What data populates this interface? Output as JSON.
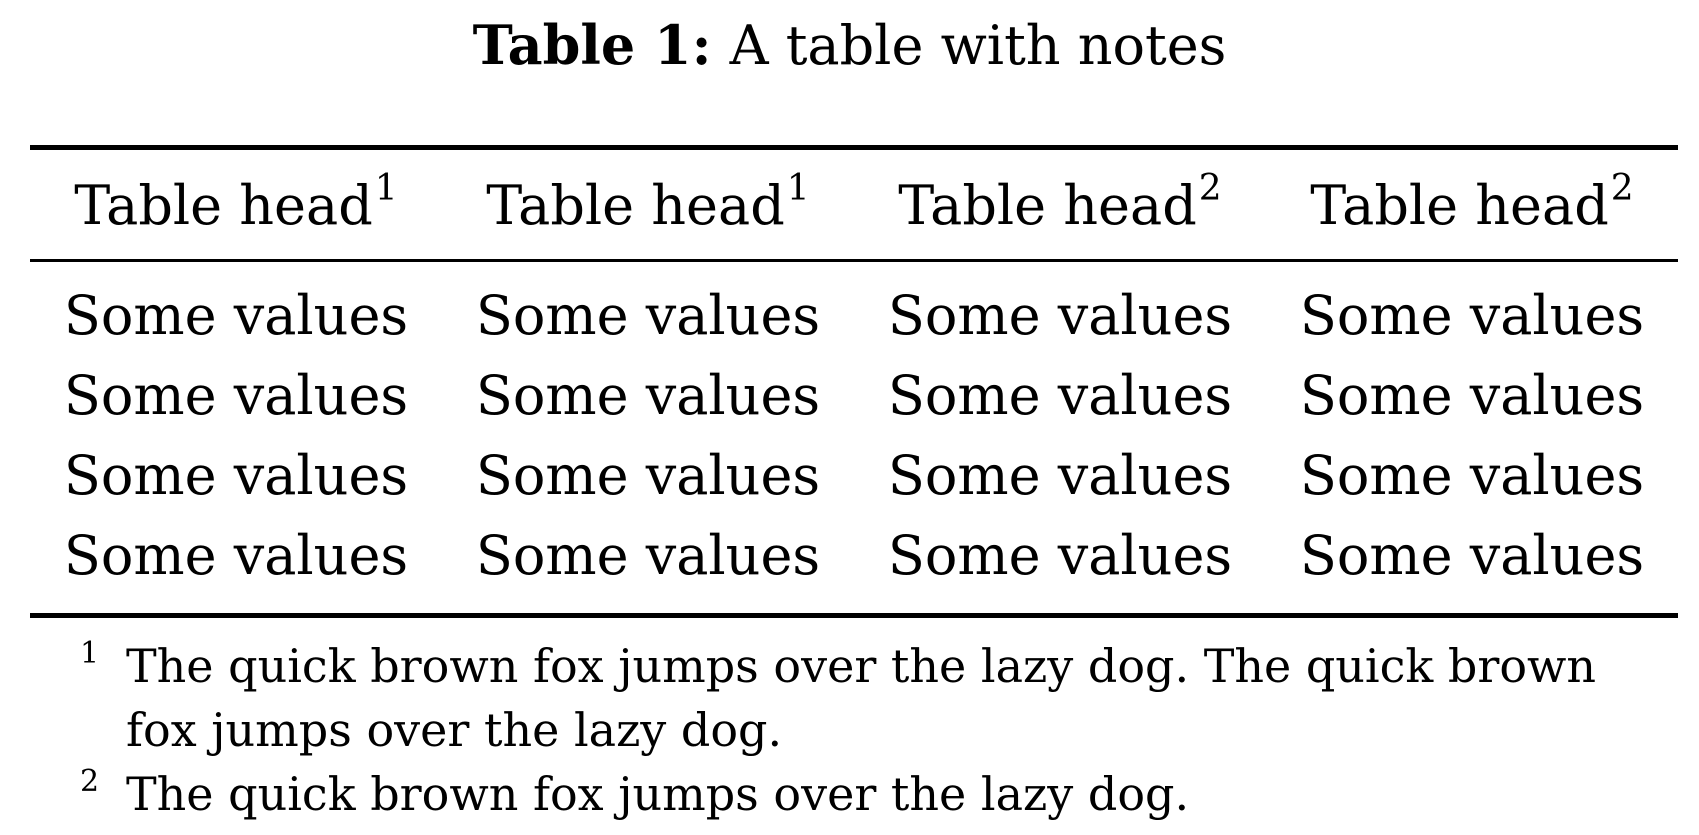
{
  "caption": {
    "label": "Table 1:",
    "text": "A table with notes"
  },
  "table": {
    "headers": [
      {
        "text": "Table head",
        "note": "1"
      },
      {
        "text": "Table head",
        "note": "1"
      },
      {
        "text": "Table head",
        "note": "2"
      },
      {
        "text": "Table head",
        "note": "2"
      }
    ],
    "rows": [
      [
        "Some values",
        "Some values",
        "Some values",
        "Some values"
      ],
      [
        "Some values",
        "Some values",
        "Some values",
        "Some values"
      ],
      [
        "Some values",
        "Some values",
        "Some values",
        "Some values"
      ],
      [
        "Some values",
        "Some values",
        "Some values",
        "Some values"
      ]
    ]
  },
  "notes": [
    {
      "mark": "1",
      "text": "The quick brown fox jumps over the lazy dog. The quick brown fox jumps over the lazy dog."
    },
    {
      "mark": "2",
      "text": "The quick brown fox jumps over the lazy dog."
    }
  ]
}
